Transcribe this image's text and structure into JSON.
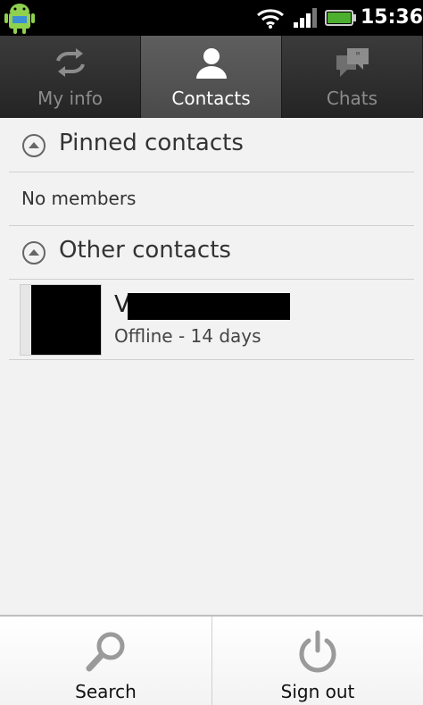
{
  "status_bar": {
    "time": "15:36",
    "icons": [
      "android-icon",
      "wifi-icon",
      "signal-icon",
      "battery-icon"
    ]
  },
  "tabs": [
    {
      "label": "My info",
      "icon": "sync-icon",
      "active": false
    },
    {
      "label": "Contacts",
      "icon": "person-icon",
      "active": true
    },
    {
      "label": "Chats",
      "icon": "chat-bubbles-icon",
      "active": false
    }
  ],
  "sections": {
    "pinned": {
      "title": "Pinned contacts",
      "empty_text": "No members"
    },
    "other": {
      "title": "Other contacts"
    }
  },
  "contacts": [
    {
      "name": "V",
      "status": "Offline - 14 days"
    }
  ],
  "actions": {
    "search_label": "Search",
    "sign_out_label": "Sign out"
  },
  "colors": {
    "tab_bar_bg": "#2b2b2b",
    "active_tab_bg": "#555555",
    "inactive_text": "#8c8c8c",
    "battery_green": "#4caf30"
  }
}
